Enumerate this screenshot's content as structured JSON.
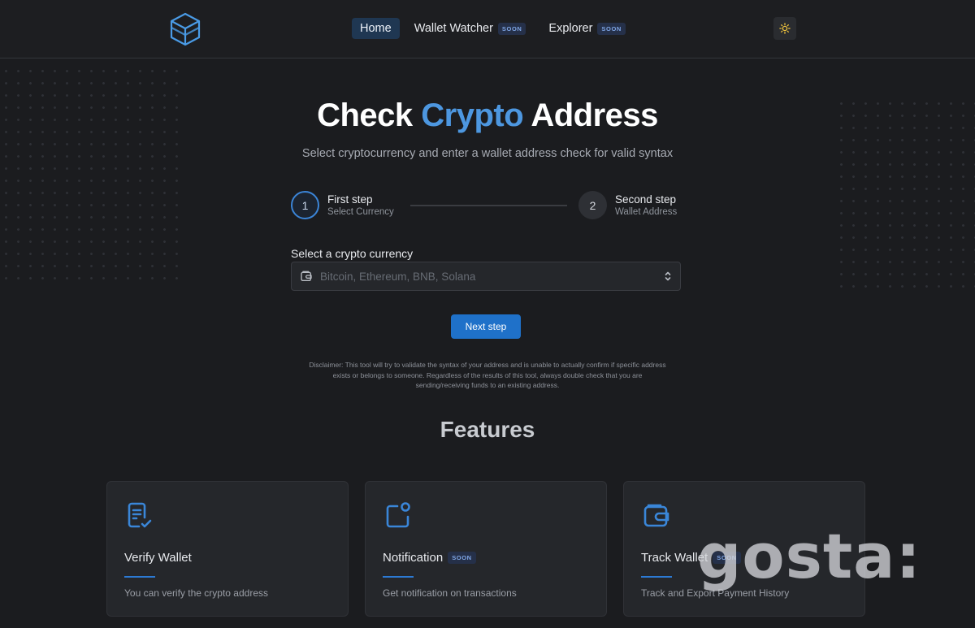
{
  "nav": {
    "items": [
      {
        "label": "Home",
        "badge": ""
      },
      {
        "label": "Wallet Watcher",
        "badge": "SOON"
      },
      {
        "label": "Explorer",
        "badge": "SOON"
      }
    ]
  },
  "hero": {
    "title_pre": "Check",
    "title_accent": "Crypto",
    "title_post": "Address",
    "subtitle": "Select cryptocurrency and enter a wallet address check for valid syntax"
  },
  "steps": [
    {
      "number": "1",
      "title": "First step",
      "desc": "Select Currency"
    },
    {
      "number": "2",
      "title": "Second step",
      "desc": "Wallet Address"
    }
  ],
  "form": {
    "label": "Select a crypto currency",
    "placeholder": "Bitcoin, Ethereum, BNB, Solana",
    "next_label": "Next step"
  },
  "disclaimer": "Disclaimer: This tool will try to validate the syntax of your address and is unable to actually confirm if specific address exists or belongs to someone. Regardless of the results of this tool, always double check that you are sending/receiving funds to an existing address.",
  "features": {
    "heading": "Features",
    "cards": [
      {
        "title": "Verify Wallet",
        "badge": "",
        "desc": "You can verify the crypto address",
        "icon": "verify-document-icon"
      },
      {
        "title": "Notification",
        "badge": "SOON",
        "desc": "Get notification on transactions",
        "icon": "notification-icon"
      },
      {
        "title": "Track Wallet",
        "badge": "SOON",
        "desc": "Track and Export Payment History",
        "icon": "wallet-icon"
      }
    ]
  },
  "watermark": "gosta:",
  "colors": {
    "accent": "#4d97e0",
    "button": "#1f71c9",
    "background": "#1b1c1f",
    "card": "#25272b"
  }
}
